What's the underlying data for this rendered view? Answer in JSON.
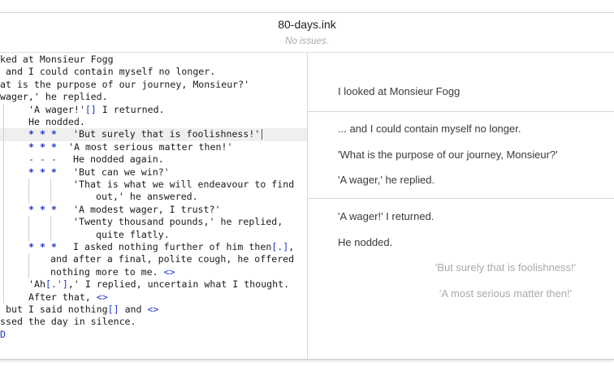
{
  "window": {
    "title": "80-days.ink",
    "status": "No issues."
  },
  "editor": {
    "lines": [
      {
        "text": "ked at Monsieur Fogg"
      },
      {
        "text": " and I could contain myself no longer."
      },
      {
        "text": "at is the purpose of our journey, Monsieur?'"
      },
      {
        "text": "wager,' he replied."
      },
      {
        "pre": "'A wager!'",
        "bracket": "[]",
        "post": " I returned."
      },
      {
        "text": "He nodded."
      },
      {
        "marker": "* * *",
        "text": "'But surely that is foolishness!'"
      },
      {
        "marker": "* * *",
        "text": "'A most serious matter then!'"
      },
      {
        "marker": "- - -",
        "text": "He nodded again."
      },
      {
        "marker": "* * *",
        "text": "'But can we win?'"
      },
      {
        "text": "'That is what we will endeavour to find"
      },
      {
        "text": "out,' he answered."
      },
      {
        "marker": "* * *",
        "text": "'A modest wager, I trust?'"
      },
      {
        "text": "'Twenty thousand pounds,' he replied,"
      },
      {
        "text": "quite flatly."
      },
      {
        "marker": "* * *",
        "pre": "I asked nothing further of him then",
        "bracket": "[.]",
        "post": ","
      },
      {
        "text": "and after a final, polite cough, he offered"
      },
      {
        "pre": "nothing more to me. ",
        "glue": "<>"
      },
      {
        "pre": "'Ah",
        "bracket": "[.']",
        "post": ",' I replied, uncertain what I thought."
      },
      {
        "pre": "After that, ",
        "glue": "<>"
      },
      {
        "pre": " but I said nothing",
        "bracket": "[]",
        "post": " and ",
        "glue": "<>"
      },
      {
        "text": "ssed the day in silence."
      },
      {
        "text": "D"
      }
    ]
  },
  "player": {
    "section1": [
      "I looked at Monsieur Fogg"
    ],
    "section2": [
      "... and I could contain myself no longer.",
      "'What is the purpose of our journey, Monsieur?'",
      "'A wager,' he replied."
    ],
    "section3": [
      "'A wager!' I returned.",
      "He nodded."
    ],
    "choices": [
      "'But surely that is foolishness!'",
      "'A most serious matter then!'"
    ]
  },
  "colors": {
    "accent": "#2038c8",
    "highlight": "#efefef",
    "choice_text": "#aaaaaa"
  }
}
